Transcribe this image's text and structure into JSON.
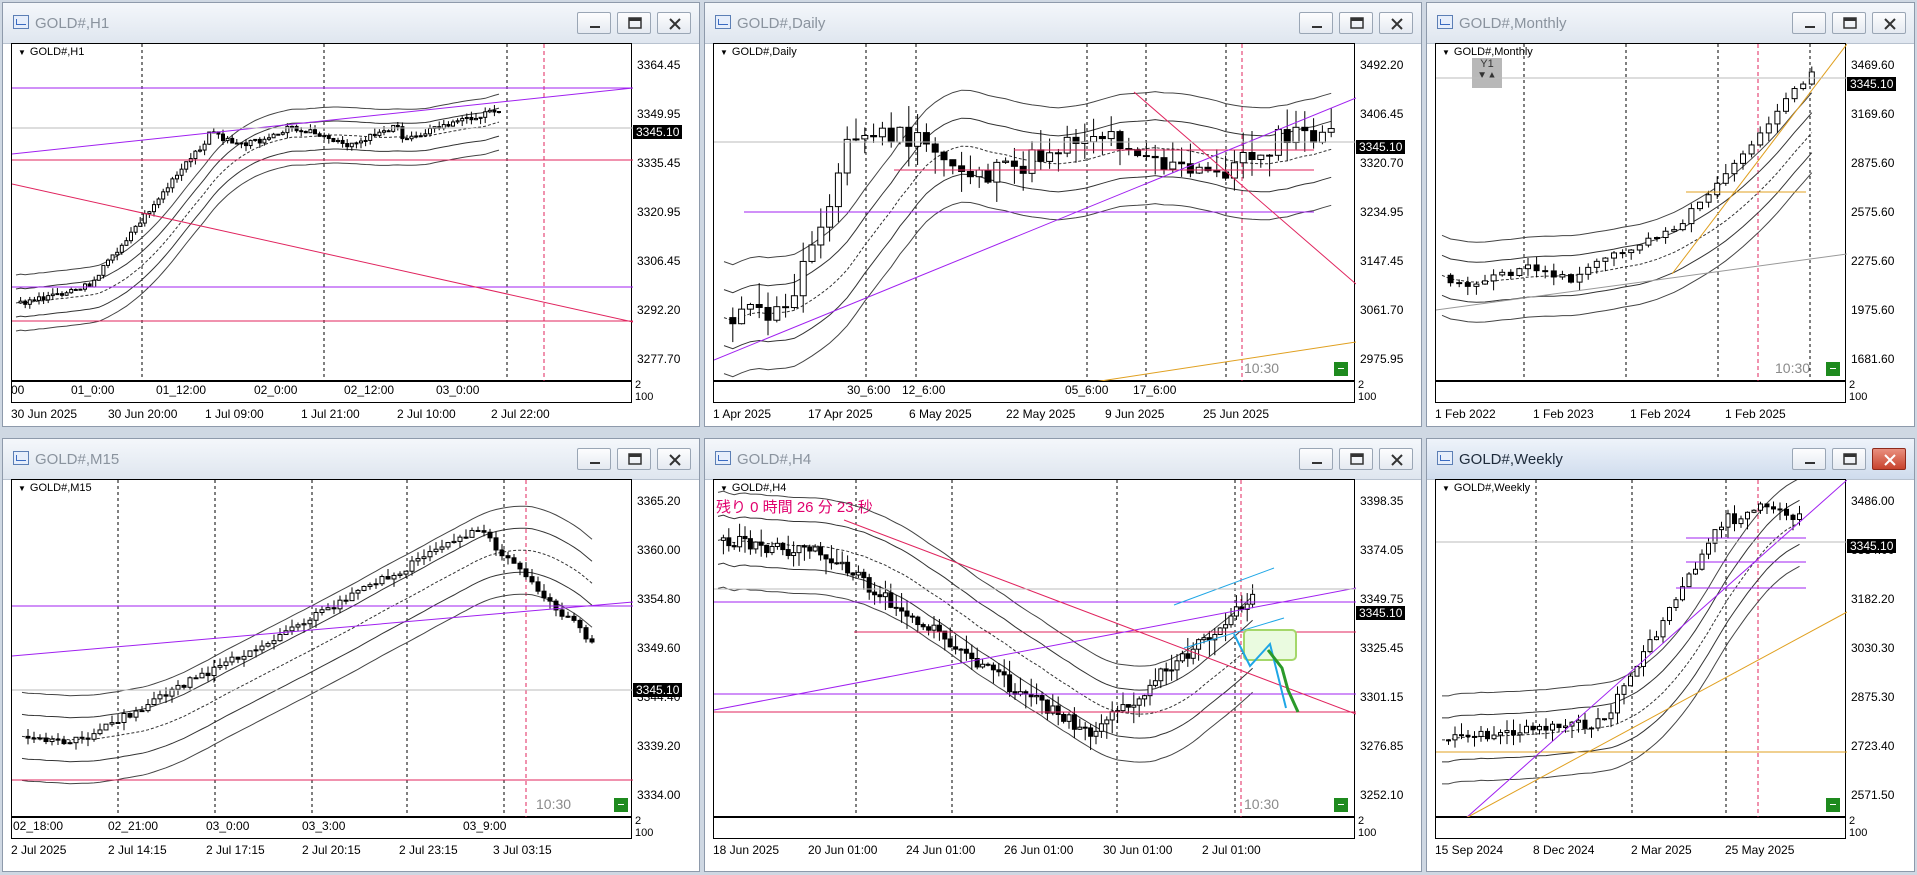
{
  "windows": [
    {
      "id": "h1",
      "title": "GOLD#,H1",
      "symbol_label": "GOLD#,H1",
      "price_ticks": [
        "3364.45",
        "3349.95",
        "3335.45",
        "3320.95",
        "3306.45",
        "3292.20",
        "3277.70"
      ],
      "current_price": "3345.10",
      "time_labels_top": [
        "00",
        "01_0:00",
        "01_12:00",
        "02_0:00",
        "02_12:00",
        "03_0:00"
      ],
      "time_labels_bottom": [
        "30 Jun 2025",
        "30 Jun 20:00",
        "1 Jul 09:00",
        "1 Jul 21:00",
        "2 Jul 10:00",
        "2 Jul 22:00"
      ],
      "sub_ticks": [
        "2",
        "0",
        "100"
      ]
    },
    {
      "id": "daily",
      "title": "GOLD#,Daily",
      "symbol_label": "GOLD#,Daily",
      "price_ticks": [
        "3492.20",
        "3406.45",
        "3320.70",
        "3234.95",
        "3147.45",
        "3061.70",
        "2975.95"
      ],
      "current_price": "3345.10",
      "time_labels_top": [
        "30_6:00",
        "12_6:00",
        "05_6:00",
        "17_6:00"
      ],
      "time_labels_bottom": [
        "1 Apr 2025",
        "17 Apr 2025",
        "6 May 2025",
        "22 May 2025",
        "9 Jun 2025",
        "25 Jun 2025"
      ],
      "countdown": "10:30",
      "sub_ticks": [
        "2",
        "0",
        "100"
      ]
    },
    {
      "id": "monthly",
      "title": "GOLD#,Monthly",
      "symbol_label": "GOLD#,Monthly",
      "price_ticks": [
        "3469.60",
        "3169.60",
        "2875.60",
        "2575.60",
        "2275.60",
        "1975.60",
        "1681.60"
      ],
      "current_price": "3345.10",
      "y1_label": "Y1",
      "time_labels_bottom": [
        "1 Feb 2022",
        "1 Feb 2023",
        "1 Feb 2024",
        "1 Feb 2025"
      ],
      "countdown": "10:30",
      "sub_ticks": [
        "2",
        "0",
        "100"
      ]
    },
    {
      "id": "m15",
      "title": "GOLD#,M15",
      "symbol_label": "GOLD#,M15",
      "price_ticks": [
        "3365.20",
        "3360.00",
        "3354.80",
        "3349.60",
        "3344.40",
        "3339.20",
        "3334.00"
      ],
      "current_price": "3345.10",
      "time_labels_top": [
        "02_18:00",
        "02_21:00",
        "03_0:00",
        "03_3:00",
        "03_9:00"
      ],
      "time_labels_bottom": [
        "2 Jul 2025",
        "2 Jul 14:15",
        "2 Jul 17:15",
        "2 Jul 20:15",
        "2 Jul 23:15",
        "3 Jul 03:15"
      ],
      "countdown": "10:30",
      "sub_ticks": [
        "2",
        "0",
        "100"
      ]
    },
    {
      "id": "h4",
      "title": "GOLD#,H4",
      "symbol_label": "GOLD#,H4",
      "timer_text": "残り 0 時間 26 分 23 秒",
      "price_ticks": [
        "3398.35",
        "3374.05",
        "3349.75",
        "3325.45",
        "3301.15",
        "3276.85",
        "3252.10"
      ],
      "current_price": "3345.10",
      "time_labels_bottom": [
        "18 Jun 2025",
        "20 Jun 01:00",
        "24 Jun 01:00",
        "26 Jun 01:00",
        "30 Jun 01:00",
        "2 Jul 01:00"
      ],
      "countdown": "10:30",
      "sub_ticks": [
        "2",
        "0",
        "100"
      ]
    },
    {
      "id": "weekly",
      "title": "GOLD#,Weekly",
      "symbol_label": "GOLD#,Weekly",
      "price_ticks": [
        "3486.00",
        "3334.00",
        "3182.20",
        "3030.30",
        "2875.30",
        "2723.40",
        "2571.50"
      ],
      "current_price": "3345.10",
      "time_labels_bottom": [
        "15 Sep 2024",
        "8 Dec 2024",
        "2 Mar 2025",
        "25 May 2025"
      ],
      "sub_ticks": [
        "2",
        "0",
        "100"
      ]
    }
  ],
  "colors": {
    "magenta_line": "#a020f0",
    "red_line": "#e0245e",
    "band": "#333333",
    "orange": "#e0a020",
    "blue": "#1ea6e6",
    "green": "#2a9a2a",
    "active_close": "#c8432d"
  }
}
